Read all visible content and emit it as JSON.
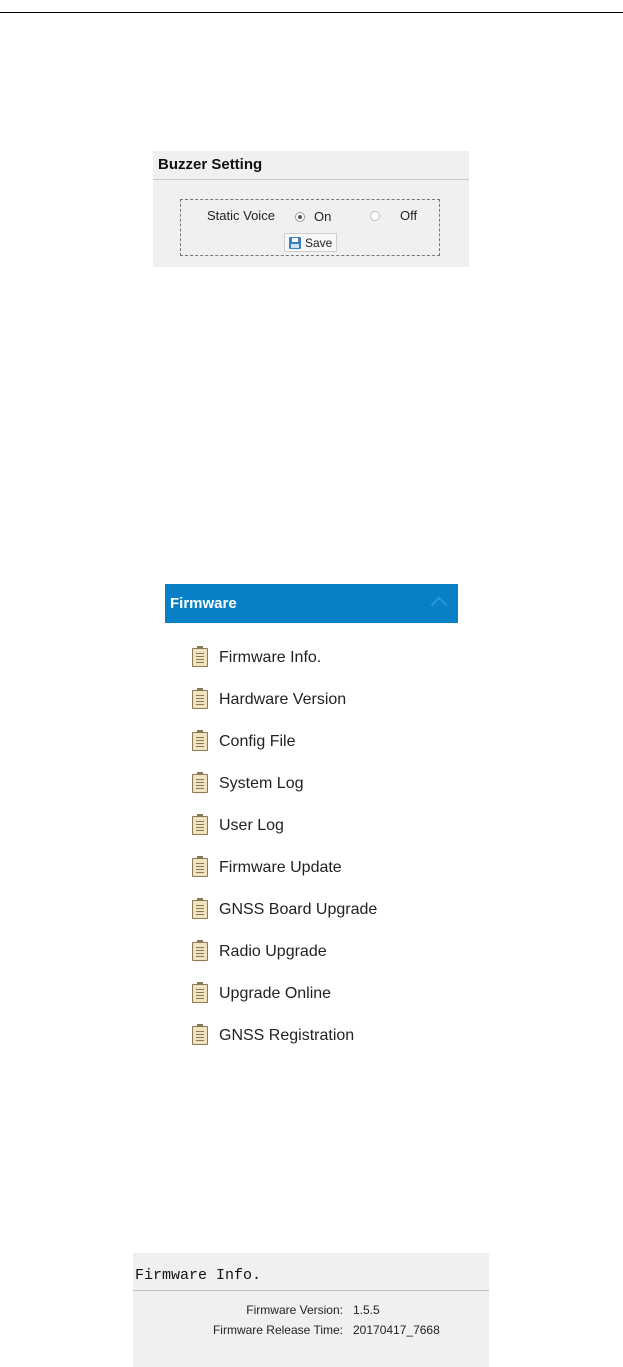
{
  "buzzer": {
    "title": "Buzzer Setting",
    "static_voice_label": "Static Voice",
    "options": [
      {
        "label": "On",
        "selected": true
      },
      {
        "label": "Off",
        "selected": false
      }
    ],
    "save_label": "Save"
  },
  "firmware_menu": {
    "title": "Firmware",
    "header_color": "#0780c8",
    "items": [
      {
        "label": "Firmware Info."
      },
      {
        "label": "Hardware Version"
      },
      {
        "label": "Config File"
      },
      {
        "label": "System Log"
      },
      {
        "label": "User Log"
      },
      {
        "label": "Firmware Update"
      },
      {
        "label": "GNSS Board Upgrade"
      },
      {
        "label": "Radio Upgrade"
      },
      {
        "label": "Upgrade Online"
      },
      {
        "label": "GNSS Registration"
      }
    ]
  },
  "firmware_info": {
    "title": "Firmware Info.",
    "rows": [
      {
        "key": "Firmware Version:",
        "value": "1.5.5"
      },
      {
        "key": "Firmware Release Time:",
        "value": "20170417_7668"
      }
    ]
  }
}
